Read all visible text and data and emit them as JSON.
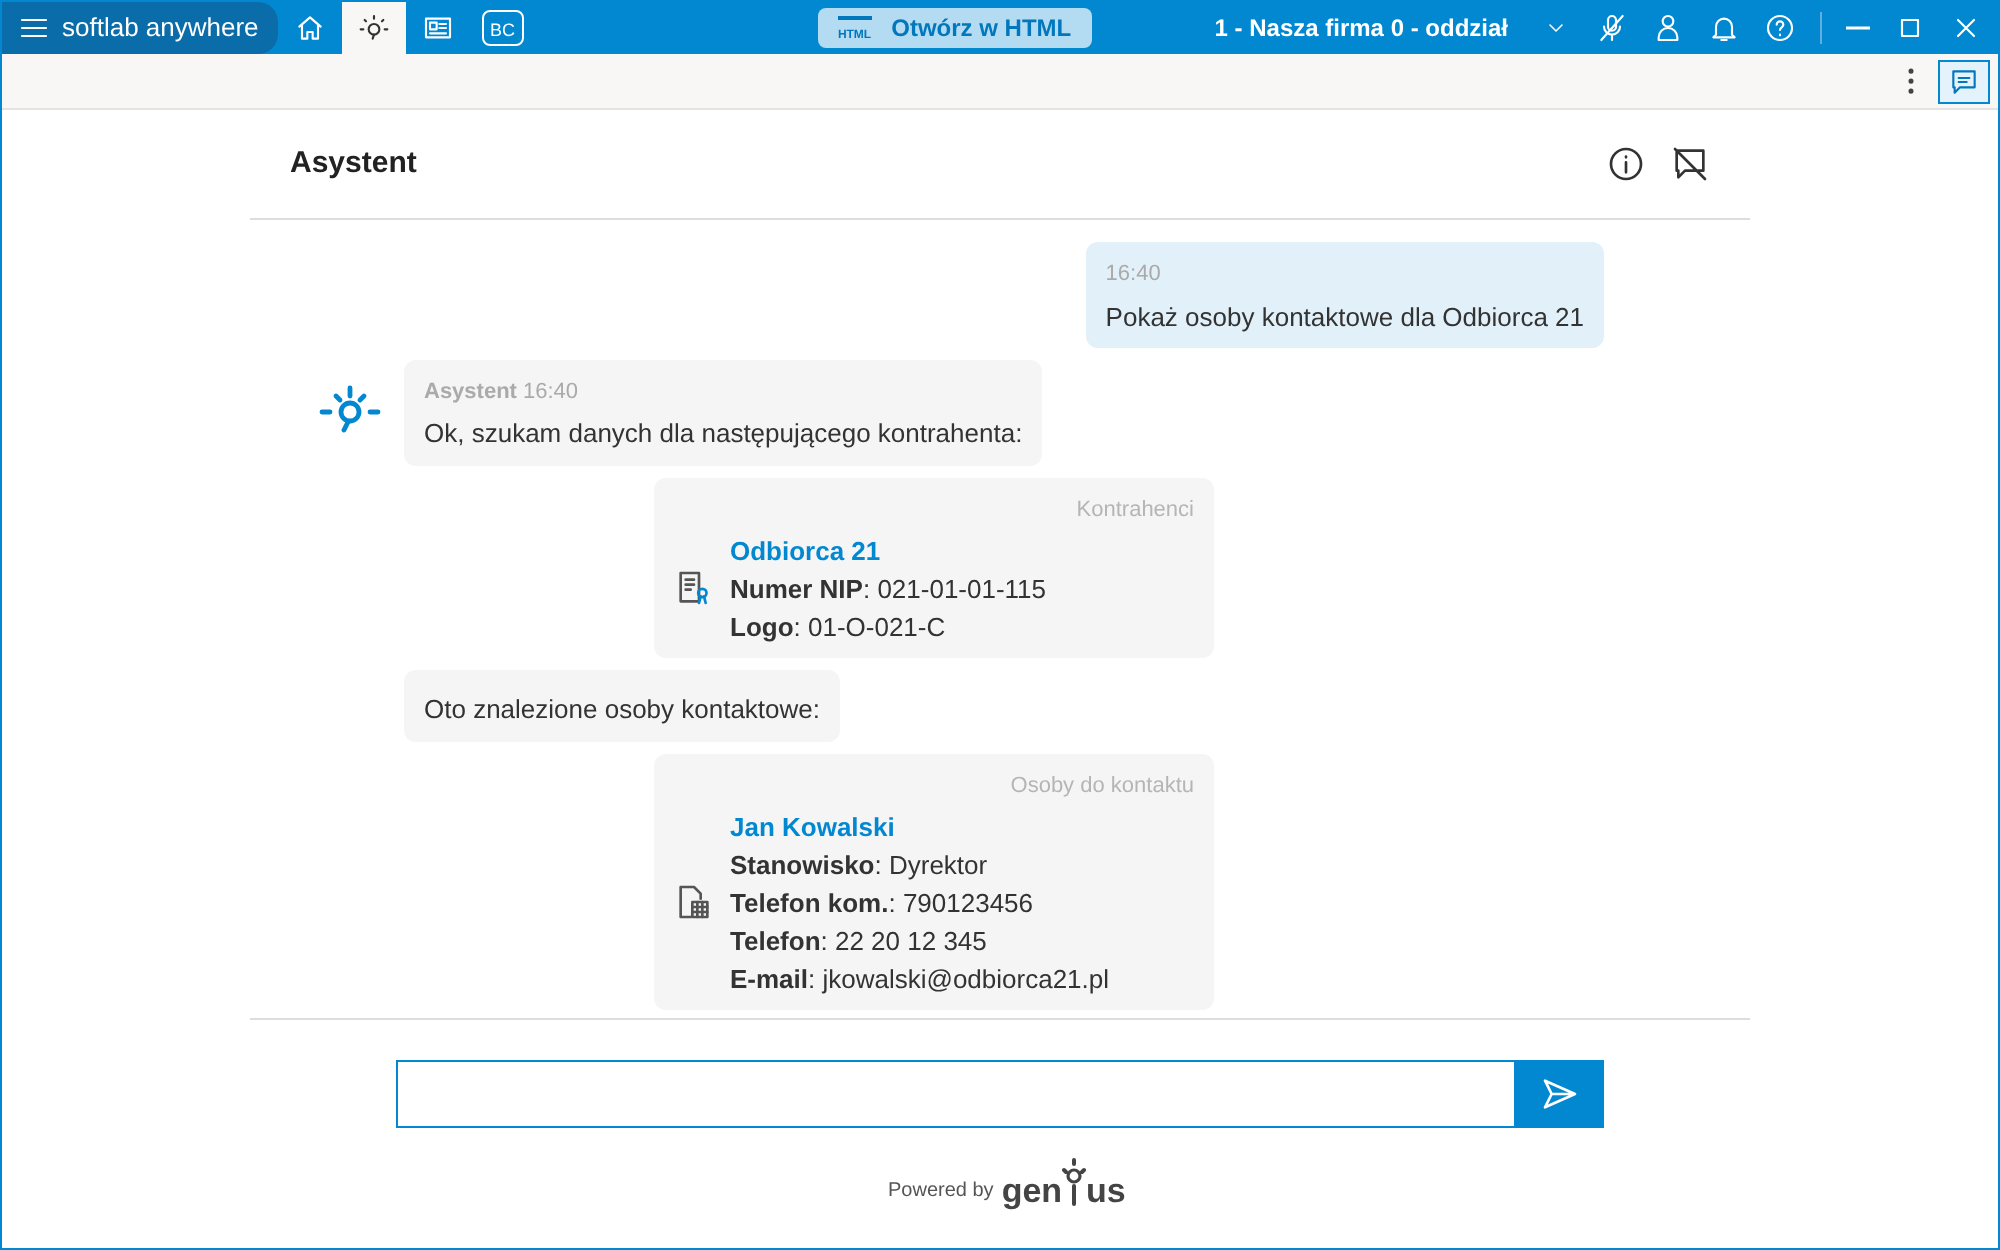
{
  "app": {
    "brand": "softlab anywhere"
  },
  "tabs": [
    {
      "kind": "home",
      "selected": false
    },
    {
      "kind": "assistant",
      "selected": true
    },
    {
      "kind": "news",
      "selected": false
    },
    {
      "kind": "bc",
      "label": "BC",
      "selected": false
    }
  ],
  "open_html": {
    "icon_label": "HTML",
    "label": "Otwórz w HTML"
  },
  "company": "1 - Nasza firma 0 - oddział",
  "panel_toggle": {
    "selected": true
  },
  "assistant": {
    "title": "Asystent"
  },
  "messages": [
    {
      "kind": "user",
      "time": "16:40",
      "text": "Pokaż osoby kontaktowe dla Odbiorca 21"
    },
    {
      "kind": "bot",
      "author": "Asystent",
      "time": "16:40",
      "text": "Ok, szukam danych dla następującego kontrahenta:"
    },
    {
      "kind": "company_card",
      "category": "Kontrahenci",
      "title": "Odbiorca 21",
      "lines": [
        "**Numer NIP**: 021-01-01-115",
        "**Logo**: 01-O-021-C"
      ]
    },
    {
      "kind": "bot",
      "text": "Oto znalezione osoby kontaktowe:"
    },
    {
      "kind": "contact_card",
      "category": "Osoby do kontaktu",
      "title": "Jan Kowalski",
      "lines": [
        "**Stanowisko**: Dyrektor",
        "**Telefon kom.**: 790123456",
        "**Telefon**: 22 20 12 345",
        "**E-mail**: jkowalski@odbiorca21.pl"
      ]
    }
  ],
  "footer": {
    "powered_by": "Powered by",
    "logo_before": "gen",
    "logo_after": "us"
  }
}
